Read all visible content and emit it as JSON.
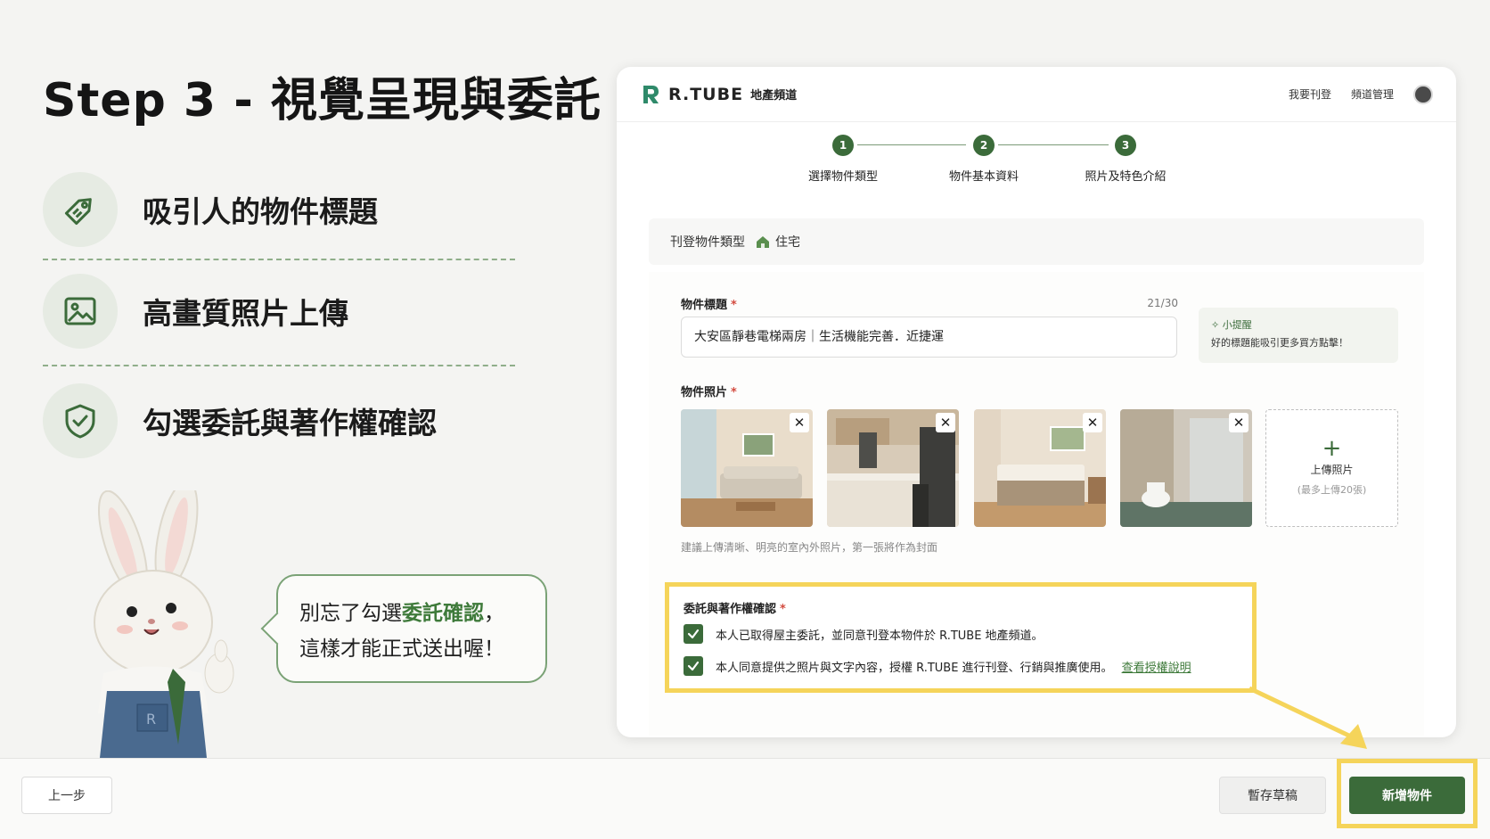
{
  "tutorial": {
    "title": "Step 3 - 視覺呈現與委託",
    "features": [
      {
        "label": "吸引人的物件標題",
        "icon": "tag-icon"
      },
      {
        "label": "高畫質照片上傳",
        "icon": "image-icon"
      },
      {
        "label": "勾選委託與著作權確認",
        "icon": "shield-check-icon"
      }
    ],
    "bubble": {
      "line1_pre": "別忘了勾選",
      "line1_highlight": "委託確認",
      "line1_post": "，",
      "line2": "這樣才能正式送出喔！"
    }
  },
  "app": {
    "brand": "R.TUBE",
    "brand_sub": "地產頻道",
    "nav": {
      "post": "我要刊登",
      "manage": "頻道管理"
    },
    "steps": [
      {
        "num": "1",
        "label": "選擇物件類型"
      },
      {
        "num": "2",
        "label": "物件基本資料"
      },
      {
        "num": "3",
        "label": "照片及特色介紹"
      }
    ],
    "type_bar": {
      "label": "刊登物件類型",
      "value": "住宅"
    },
    "title_field": {
      "label": "物件標題",
      "required": "*",
      "counter": "21/30",
      "value": "大安區靜巷電梯兩房｜生活機能完善．近捷運"
    },
    "tip": {
      "head": "✧ 小提醒",
      "body": "好的標題能吸引更多買方點擊！"
    },
    "photos": {
      "label": "物件照片",
      "required": "*",
      "remove": "✕",
      "upload_plus": "+",
      "upload_label": "上傳照片",
      "upload_hint": "(最多上傳20張)",
      "hint": "建議上傳清晰、明亮的室內外照片，第一張將作為封面"
    },
    "consent": {
      "title": "委託與著作權確認",
      "required": "*",
      "items": [
        "本人已取得屋主委託，並同意刊登本物件於 R.TUBE 地產頻道。",
        "本人同意提供之照片與文字內容，授權 R.TUBE 進行刊登、行銷與推廣使用。"
      ],
      "link": "查看授權說明"
    }
  },
  "bottom": {
    "prev": "上一步",
    "draft": "暫存草稿",
    "submit": "新增物件"
  },
  "colors": {
    "brand_green": "#3b6b3a",
    "highlight_yellow": "#f5d45a"
  }
}
